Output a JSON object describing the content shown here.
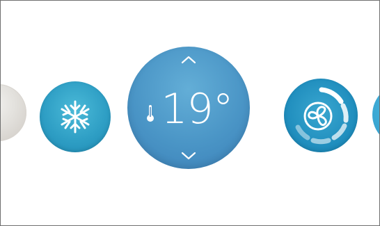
{
  "climate": {
    "temperature": {
      "value": "19°",
      "icon": "thermometer-icon"
    },
    "modes": [
      {
        "name": "unknown-knob",
        "icon": "none",
        "state": "partial"
      },
      {
        "name": "cooling",
        "icon": "snowflake-icon"
      },
      {
        "name": "fan",
        "icon": "fan-icon",
        "level": 0.6
      },
      {
        "name": "next-control",
        "icon": "none",
        "state": "partial"
      }
    ],
    "controls": {
      "up": "chevron-up-icon",
      "down": "chevron-down-icon"
    },
    "colors": {
      "accent": "#2f9fc5",
      "temp_knob": "#4a95c6",
      "fan_knob": "#1f8dbd",
      "inactive_knob": "#e3e1dd",
      "icon": "#ffffff",
      "frame": "#6f6f6f",
      "background": "#ffffff"
    }
  }
}
